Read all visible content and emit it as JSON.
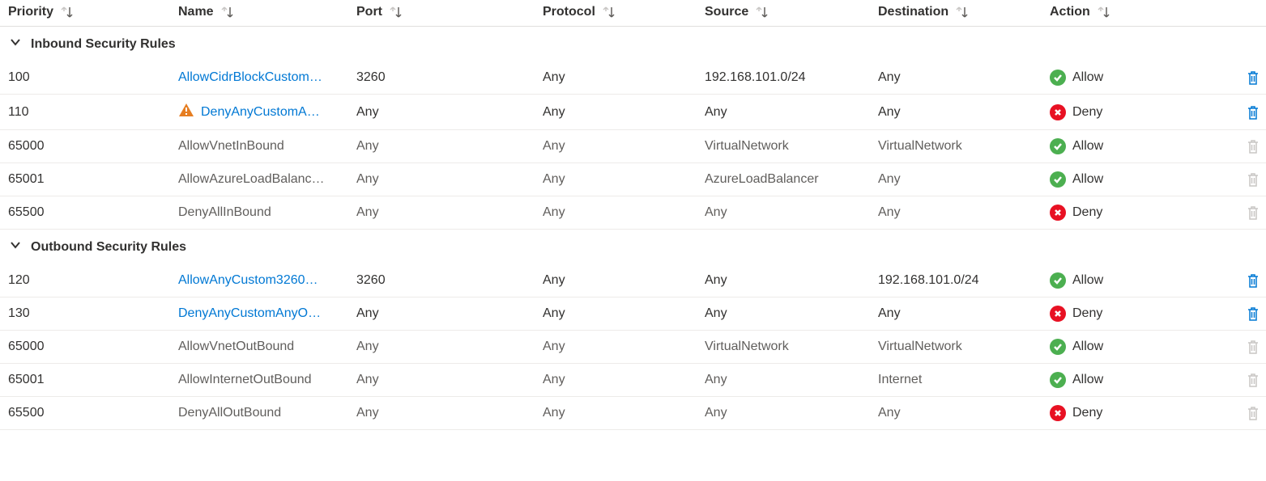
{
  "columns": [
    {
      "key": "priority",
      "label": "Priority"
    },
    {
      "key": "name",
      "label": "Name"
    },
    {
      "key": "port",
      "label": "Port"
    },
    {
      "key": "protocol",
      "label": "Protocol"
    },
    {
      "key": "source",
      "label": "Source"
    },
    {
      "key": "destination",
      "label": "Destination"
    },
    {
      "key": "action",
      "label": "Action"
    }
  ],
  "groups": [
    {
      "title": "Inbound Security Rules",
      "rows": [
        {
          "priority": "100",
          "name": "AllowCidrBlockCustom",
          "warning": false,
          "link": true,
          "truncated": true,
          "port": "3260",
          "protocol": "Any",
          "source": "192.168.101.0/24",
          "destination": "Any",
          "action": "Allow",
          "default": false
        },
        {
          "priority": "110",
          "name": "DenyAnyCustomA",
          "warning": true,
          "link": true,
          "truncated": true,
          "port": "Any",
          "protocol": "Any",
          "source": "Any",
          "destination": "Any",
          "action": "Deny",
          "default": false
        },
        {
          "priority": "65000",
          "name": "AllowVnetInBound",
          "warning": false,
          "link": false,
          "truncated": false,
          "port": "Any",
          "protocol": "Any",
          "source": "VirtualNetwork",
          "destination": "VirtualNetwork",
          "action": "Allow",
          "default": true
        },
        {
          "priority": "65001",
          "name": "AllowAzureLoadBalanc",
          "warning": false,
          "link": false,
          "truncated": true,
          "port": "Any",
          "protocol": "Any",
          "source": "AzureLoadBalancer",
          "destination": "Any",
          "action": "Allow",
          "default": true
        },
        {
          "priority": "65500",
          "name": "DenyAllInBound",
          "warning": false,
          "link": false,
          "truncated": false,
          "port": "Any",
          "protocol": "Any",
          "source": "Any",
          "destination": "Any",
          "action": "Deny",
          "default": true
        }
      ]
    },
    {
      "title": "Outbound Security Rules",
      "rows": [
        {
          "priority": "120",
          "name": "AllowAnyCustom3260",
          "warning": false,
          "link": true,
          "truncated": true,
          "port": "3260",
          "protocol": "Any",
          "source": "Any",
          "destination": "192.168.101.0/24",
          "action": "Allow",
          "default": false
        },
        {
          "priority": "130",
          "name": "DenyAnyCustomAnyOu",
          "warning": false,
          "link": true,
          "truncated": true,
          "port": "Any",
          "protocol": "Any",
          "source": "Any",
          "destination": "Any",
          "action": "Deny",
          "default": false
        },
        {
          "priority": "65000",
          "name": "AllowVnetOutBound",
          "warning": false,
          "link": false,
          "truncated": false,
          "port": "Any",
          "protocol": "Any",
          "source": "VirtualNetwork",
          "destination": "VirtualNetwork",
          "action": "Allow",
          "default": true
        },
        {
          "priority": "65001",
          "name": "AllowInternetOutBound",
          "warning": false,
          "link": false,
          "truncated": false,
          "port": "Any",
          "protocol": "Any",
          "source": "Any",
          "destination": "Internet",
          "action": "Allow",
          "default": true
        },
        {
          "priority": "65500",
          "name": "DenyAllOutBound",
          "warning": false,
          "link": false,
          "truncated": false,
          "port": "Any",
          "protocol": "Any",
          "source": "Any",
          "destination": "Any",
          "action": "Deny",
          "default": true
        }
      ]
    }
  ]
}
